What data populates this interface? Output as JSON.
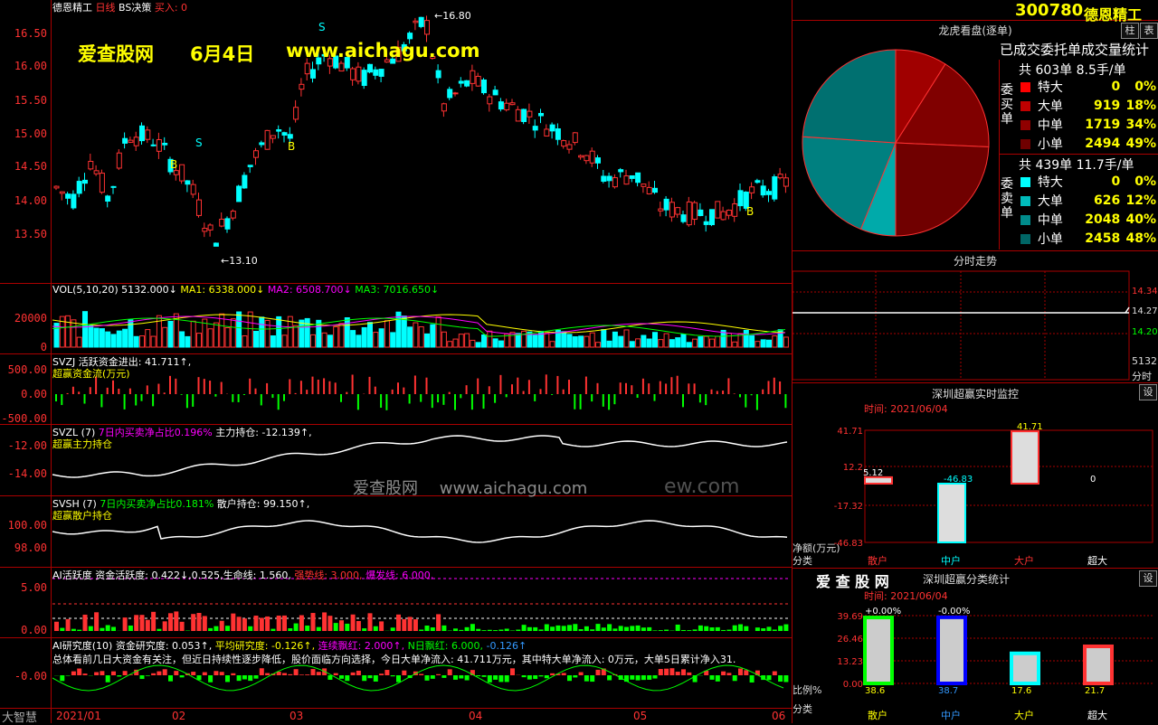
{
  "header": {
    "stock_name": "德恩精工",
    "period": "日线",
    "indicator": "BS决策",
    "buy_label": "买入: 0",
    "code": "300780",
    "name_right": "德恩精工"
  },
  "watermark": {
    "site": "爱查股网",
    "date": "6月4日",
    "url": "www.aichagu.com",
    "mid_text": "爱查股网　 www.aichagu.com",
    "mid_tail": "ew.com"
  },
  "price_axis": [
    "16.50",
    "16.00",
    "15.50",
    "15.00",
    "14.50",
    "14.00",
    "13.50"
  ],
  "price_marks": {
    "high": "16.80",
    "low": "13.10"
  },
  "vol": {
    "label": "VOL(5,10,20) 5132.000↓",
    "ma1": "MA1: 6338.000↓",
    "ma2": "MA2: 6508.700↓",
    "ma3": "MA3: 7016.650↓",
    "axis": [
      "20000",
      "0"
    ]
  },
  "svzj": {
    "title": "SVZJ  活跃资金进出: 41.711↑,",
    "sub": "超赢资金流(万元)",
    "axis": [
      "500.00",
      "0.00",
      "-500.00"
    ]
  },
  "svzl": {
    "title_a": "SVZL (7)",
    "title_b": "7日内买卖净占比0.196%",
    "title_c": "主力持仓: -12.139↑,",
    "sub": "超赢主力持仓",
    "axis": [
      "-12.00",
      "-14.00"
    ]
  },
  "svsh": {
    "title_a": "SVSH (7)",
    "title_b": "7日内买卖净占比0.181%",
    "title_c": "散户持仓: 99.150↑,",
    "sub": "超赢散户持仓",
    "axis": [
      "100.00",
      "98.00"
    ]
  },
  "ai1": {
    "a": "AI活跃度 资金活跃度: 0.422↓,0.525,生命线: 1.560,",
    "b": "强势线: 3.000,",
    "c": "爆发线: 6.000,",
    "axis": [
      "5.00",
      "0.00"
    ]
  },
  "ai2": {
    "a": "AI研究度(10) 资金研究度: 0.053↑,",
    "b": "平均研究度: -0.126↑,",
    "c": "连续飘红: 2.000↑,",
    "d": "N日飘红: 6.000,",
    "e": "-0.126↑",
    "comment": "总体看前几日大资金有关注，但近日持续性逐步降低，股价面临方向选择，今日大单净流入: 41.711万元，其中特大单净流入: 0万元，大单5日累计净入31.",
    "axis": [
      "-0.00"
    ]
  },
  "date_axis": [
    "2021/01",
    "02",
    "03",
    "04",
    "05",
    "06"
  ],
  "brand": "大智慧",
  "dragon": {
    "title": "龙虎看盘(逐单)",
    "stat_title": "已成交委托单成交量统计",
    "buy": {
      "label": "委买单",
      "total": "共 603单 8.5手/单",
      "rows": [
        {
          "cat": "特大",
          "val": "0",
          "pct": "0%",
          "color": "#ff0000"
        },
        {
          "cat": "大单",
          "val": "919",
          "pct": "18%",
          "color": "#c00000"
        },
        {
          "cat": "中单",
          "val": "1719",
          "pct": "34%",
          "color": "#900000"
        },
        {
          "cat": "小单",
          "val": "2494",
          "pct": "49%",
          "color": "#700000"
        }
      ]
    },
    "sell": {
      "label": "委卖单",
      "total": "共 439单 11.7手/单",
      "rows": [
        {
          "cat": "特大",
          "val": "0",
          "pct": "0%",
          "color": "#00ffff"
        },
        {
          "cat": "大单",
          "val": "626",
          "pct": "12%",
          "color": "#00bbbb"
        },
        {
          "cat": "中单",
          "val": "2048",
          "pct": "40%",
          "color": "#008b8b"
        },
        {
          "cat": "小单",
          "val": "2458",
          "pct": "48%",
          "color": "#006666"
        }
      ]
    }
  },
  "btn_zhu": "柱",
  "btn_biao": "表",
  "btn_she": "设",
  "fenshi": {
    "title": "分时走势",
    "axis": [
      "14.34",
      "14.27",
      "14.20"
    ],
    "vol": "5132",
    "label": "分时"
  },
  "monitor": {
    "title": "深圳超赢实时监控",
    "time": "时间: 2021/06/04",
    "axis": [
      "41.71",
      "12.2",
      "-17.32",
      "-46.83"
    ],
    "ylabel": "净额(万元)",
    "xlabel": "分类",
    "cats": [
      "散户",
      "中户",
      "大户",
      "超大"
    ],
    "values": [
      "5.12",
      "-46.83",
      "41.71",
      "0"
    ],
    "nums": [
      5.12,
      -46.83,
      41.71,
      0
    ]
  },
  "classify": {
    "brand": "爱 查 股 网",
    "title": "深圳超赢分类统计",
    "time": "时间: 2021/06/04",
    "axis": [
      "39.69",
      "26.46",
      "13.23",
      "0.00"
    ],
    "top": [
      "+0.00%",
      "-0.00%"
    ],
    "ylabel": "比例%",
    "xlabel": "分类",
    "vals": [
      "38.6",
      "38.7",
      "17.6",
      "21.7"
    ],
    "nums": [
      38.6,
      38.7,
      17.6,
      21.7
    ],
    "cats": [
      "散户",
      "中户",
      "大户",
      "超大"
    ]
  },
  "chart_data": {
    "type": "pie",
    "title": "已成交委托单成交量统计",
    "labels": [
      "委买 特大",
      "委买 大单",
      "委买 中单",
      "委买 小单",
      "委卖 特大",
      "委卖 大单",
      "委卖 中单",
      "委卖 小单"
    ],
    "values": [
      0,
      919,
      1719,
      2494,
      0,
      626,
      2048,
      2458
    ]
  }
}
